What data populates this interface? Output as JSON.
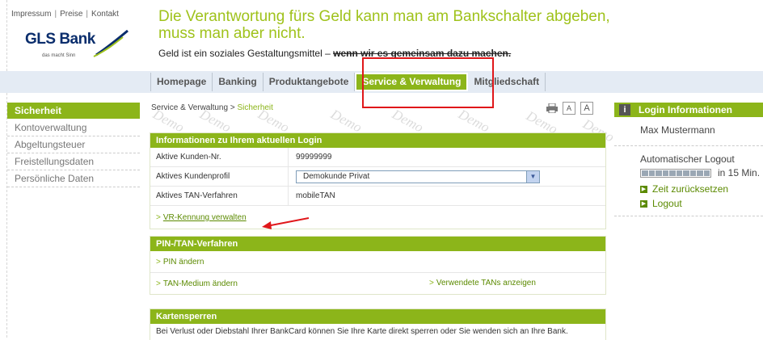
{
  "top_links": [
    "Impressum",
    "Preise",
    "Kontakt"
  ],
  "brand": {
    "name": "GLS Bank",
    "tagline": "das macht Sinn"
  },
  "headline": "Die Verantwortung fürs Geld kann man am Bankschalter abgeben, muss man aber nicht.",
  "subline": {
    "text": "Geld ist ein soziales Gestaltungsmittel –",
    "bold": "wenn wir es gemeinsam dazu machen."
  },
  "nav": [
    "Homepage",
    "Banking",
    "Produktangebote",
    "Service & Verwaltung",
    "Mitgliedschaft"
  ],
  "sidebar": [
    "Sicherheit",
    "Kontoverwaltung",
    "Abgeltungsteuer",
    "Freistellungsdaten",
    "Persönliche Daten"
  ],
  "breadcrumb": {
    "parent": "Service & Verwaltung",
    "sep": ">",
    "current": "Sicherheit"
  },
  "tools": {
    "small": "A",
    "large": "A"
  },
  "watermark": "Demo",
  "login_panel": {
    "title": "Informationen zu Ihrem aktuellen Login",
    "rows": [
      {
        "label": "Aktive Kunden-Nr.",
        "value": "99999999"
      },
      {
        "label": "Aktives Kundenprofil",
        "value": "Demokunde Privat"
      },
      {
        "label": "Aktives TAN-Verfahren",
        "value": "mobileTAN"
      }
    ],
    "link": "VR-Kennung verwalten"
  },
  "pin_panel": {
    "title": "PIN-/TAN-Verfahren",
    "links": [
      "PIN ändern",
      "TAN-Medium ändern",
      "Verwendete TANs anzeigen"
    ]
  },
  "card_panel": {
    "title": "Kartensperren",
    "text": "Bei Verlust oder Diebstahl Ihrer BankCard können Sie Ihre Karte direkt sperren oder Sie wenden sich an Ihre Bank."
  },
  "login_info": {
    "title": "Login Informationen",
    "icon": "info-icon",
    "user": "Max Mustermann",
    "logout_label": "Automatischer Logout",
    "logout_time": "in 15 Min.",
    "links": [
      "Zeit zurücksetzen",
      "Logout"
    ]
  },
  "colors": {
    "accent": "#8cb51a",
    "headline": "#9fc21b",
    "highlight": "#e0171a",
    "nav_bg": "#e4ebf4"
  }
}
